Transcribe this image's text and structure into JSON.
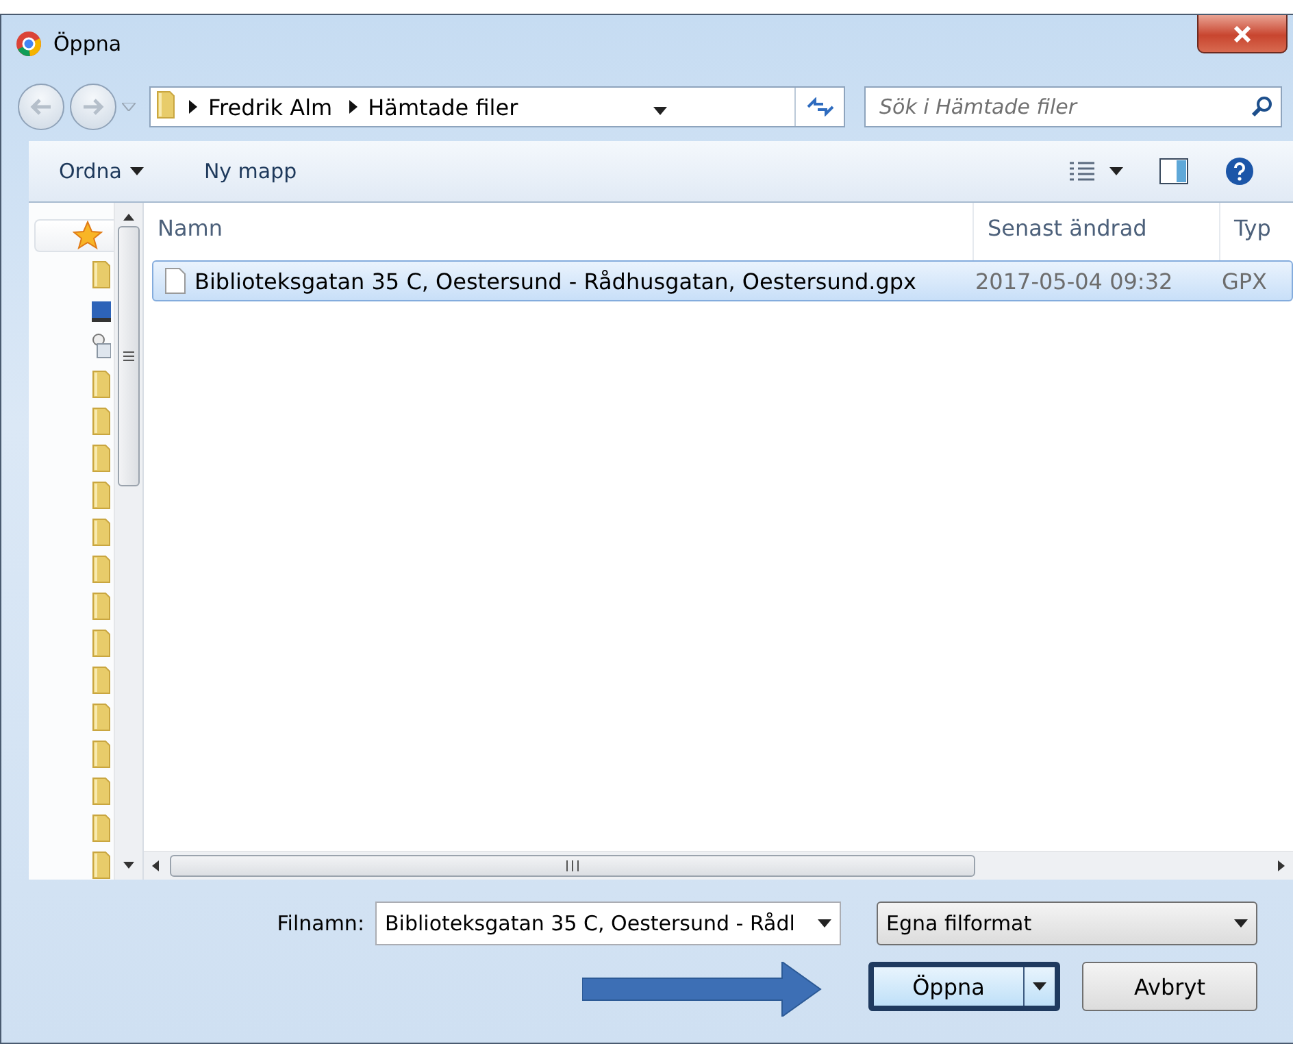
{
  "window": {
    "title": "Öppna"
  },
  "address": {
    "crumbs": [
      "Fredrik Alm",
      "Hämtade filer"
    ]
  },
  "search": {
    "placeholder": "Sök i Hämtade filer"
  },
  "toolbar": [
    {
      "label": "Ordna",
      "dropdown": true
    },
    {
      "label": "Ny mapp",
      "dropdown": false
    }
  ],
  "table": {
    "columns": [
      "Namn",
      "Senast ändrad",
      "Typ"
    ],
    "rows": [
      {
        "name": "Biblioteksgatan 35 C, Oestersund - Rådhusgatan, Oestersund.gpx",
        "modified": "2017-05-04 09:32",
        "type": "GPX",
        "selected": true
      }
    ]
  },
  "filename": {
    "label": "Filnamn:",
    "value": "Biblioteksgatan 35 C, Oestersund - Rådl"
  },
  "filter": {
    "value": "Egna filformat"
  },
  "buttons": [
    {
      "label": "Öppna",
      "default": true
    },
    {
      "label": "Avbryt",
      "default": false
    }
  ]
}
